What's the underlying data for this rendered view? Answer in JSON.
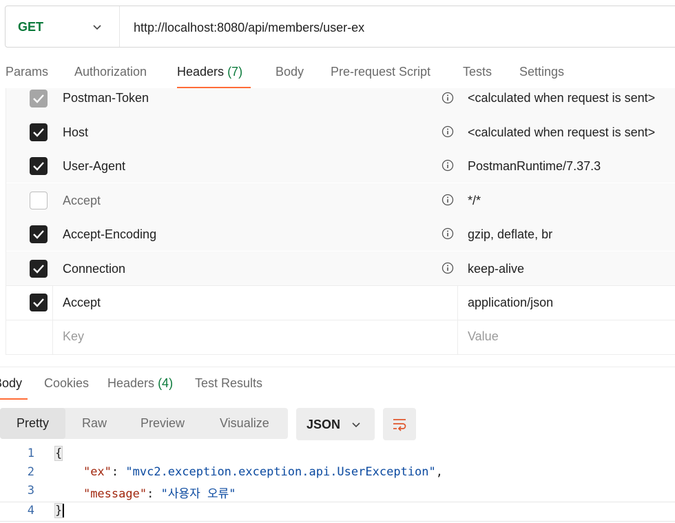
{
  "request": {
    "method": "GET",
    "url": "http://localhost:8080/api/members/user-ex"
  },
  "request_tabs": {
    "params": "Params",
    "authorization": "Authorization",
    "headers": "Headers",
    "headers_count": "(7)",
    "body": "Body",
    "pre_request": "Pre-request Script",
    "tests": "Tests",
    "settings": "Settings"
  },
  "headers": [
    {
      "key": "Postman-Token",
      "value": "<calculated when request is sent>",
      "checked": true,
      "auto": true
    },
    {
      "key": "Host",
      "value": "<calculated when request is sent>",
      "checked": true,
      "auto": true
    },
    {
      "key": "User-Agent",
      "value": "PostmanRuntime/7.37.3",
      "checked": true,
      "auto": true
    },
    {
      "key": "Accept",
      "value": "*/*",
      "checked": false,
      "auto": true
    },
    {
      "key": "Accept-Encoding",
      "value": "gzip, deflate, br",
      "checked": true,
      "auto": true
    },
    {
      "key": "Connection",
      "value": "keep-alive",
      "checked": true,
      "auto": true
    },
    {
      "key": "Accept",
      "value": "application/json",
      "checked": true,
      "auto": false
    }
  ],
  "new_row": {
    "key_placeholder": "Key",
    "value_placeholder": "Value"
  },
  "response_tabs": {
    "body": "Body",
    "cookies": "Cookies",
    "headers": "Headers",
    "headers_count": "(4)",
    "test_results": "Test Results"
  },
  "view_modes": {
    "pretty": "Pretty",
    "raw": "Raw",
    "preview": "Preview",
    "visualize": "Visualize",
    "format": "JSON"
  },
  "code": {
    "line_numbers": [
      "1",
      "2",
      "3",
      "4"
    ],
    "open_brace": "{",
    "close_brace": "}",
    "ex_key": "\"ex\"",
    "ex_value": "\"mvc2.exception.exception.api.UserException\"",
    "message_key": "\"message\"",
    "message_value": "\"사용자 오류\""
  },
  "colors": {
    "accent": "#ff6c37",
    "method_green": "#0b7a3b",
    "json_key": "#a1260d",
    "json_string": "#0b4aa0"
  }
}
